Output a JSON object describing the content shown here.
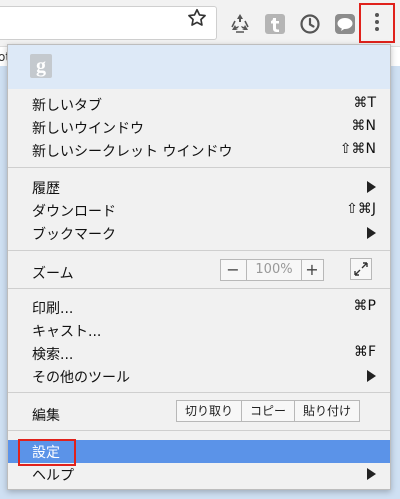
{
  "toolbar": {
    "icons": [
      "star-icon",
      "recycle-icon",
      "tumblr-icon",
      "history-clock-icon",
      "line-icon",
      "more-vert-icon"
    ]
  },
  "page_behind": {
    "fragment": "ot"
  },
  "menu": {
    "group1": [
      {
        "label": "新しいタブ",
        "shortcut": "⌘T"
      },
      {
        "label": "新しいウインドウ",
        "shortcut": "⌘N"
      },
      {
        "label": "新しいシークレット ウインドウ",
        "shortcut": "⇧⌘N"
      }
    ],
    "group2": [
      {
        "label": "履歴",
        "submenu": true
      },
      {
        "label": "ダウンロード",
        "shortcut": "⇧⌘J"
      },
      {
        "label": "ブックマーク",
        "submenu": true
      }
    ],
    "zoom": {
      "label": "ズーム",
      "minus": "−",
      "value": "100%",
      "plus": "+"
    },
    "group3": [
      {
        "label": "印刷...",
        "shortcut": "⌘P"
      },
      {
        "label": "キャスト..."
      },
      {
        "label": "検索...",
        "shortcut": "⌘F"
      },
      {
        "label": "その他のツール",
        "submenu": true
      }
    ],
    "edit": {
      "label": "編集",
      "cut": "切り取り",
      "copy": "コピー",
      "paste": "貼り付け"
    },
    "settings": {
      "label": "設定"
    },
    "help": {
      "label": "ヘルプ",
      "submenu": true
    }
  },
  "colors": {
    "highlight": "#5b93e8",
    "annotation_box": "#e0221c"
  }
}
